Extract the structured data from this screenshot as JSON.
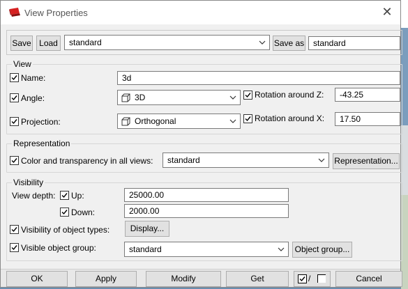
{
  "window": {
    "title": "View Properties"
  },
  "top": {
    "save": "Save",
    "load": "Load",
    "preset": "standard",
    "save_as": "Save as",
    "save_as_name": "standard"
  },
  "view": {
    "group": "View",
    "name_label": "Name:",
    "name_value": "3d",
    "angle_label": "Angle:",
    "angle_value": "3D",
    "rotz_label": "Rotation around Z:",
    "rotz_value": "-43.25",
    "projection_label": "Projection:",
    "projection_value": "Orthogonal",
    "rotx_label": "Rotation around X:",
    "rotx_value": "17.50"
  },
  "representation": {
    "group": "Representation",
    "color_label": "Color and transparency in all views:",
    "color_value": "standard",
    "button": "Representation..."
  },
  "visibility": {
    "group": "Visibility",
    "depth_label": "View depth:",
    "up_label": "Up:",
    "up_value": "25000.00",
    "down_label": "Down:",
    "down_value": "2000.00",
    "objtypes_label": "Visibility of object types:",
    "display_button": "Display...",
    "objgroup_label": "Visible object group:",
    "objgroup_value": "standard",
    "objgroup_button": "Object group..."
  },
  "footer": {
    "ok": "OK",
    "apply": "Apply",
    "modify": "Modify",
    "get": "Get",
    "toggle_sep": "/",
    "cancel": "Cancel"
  }
}
